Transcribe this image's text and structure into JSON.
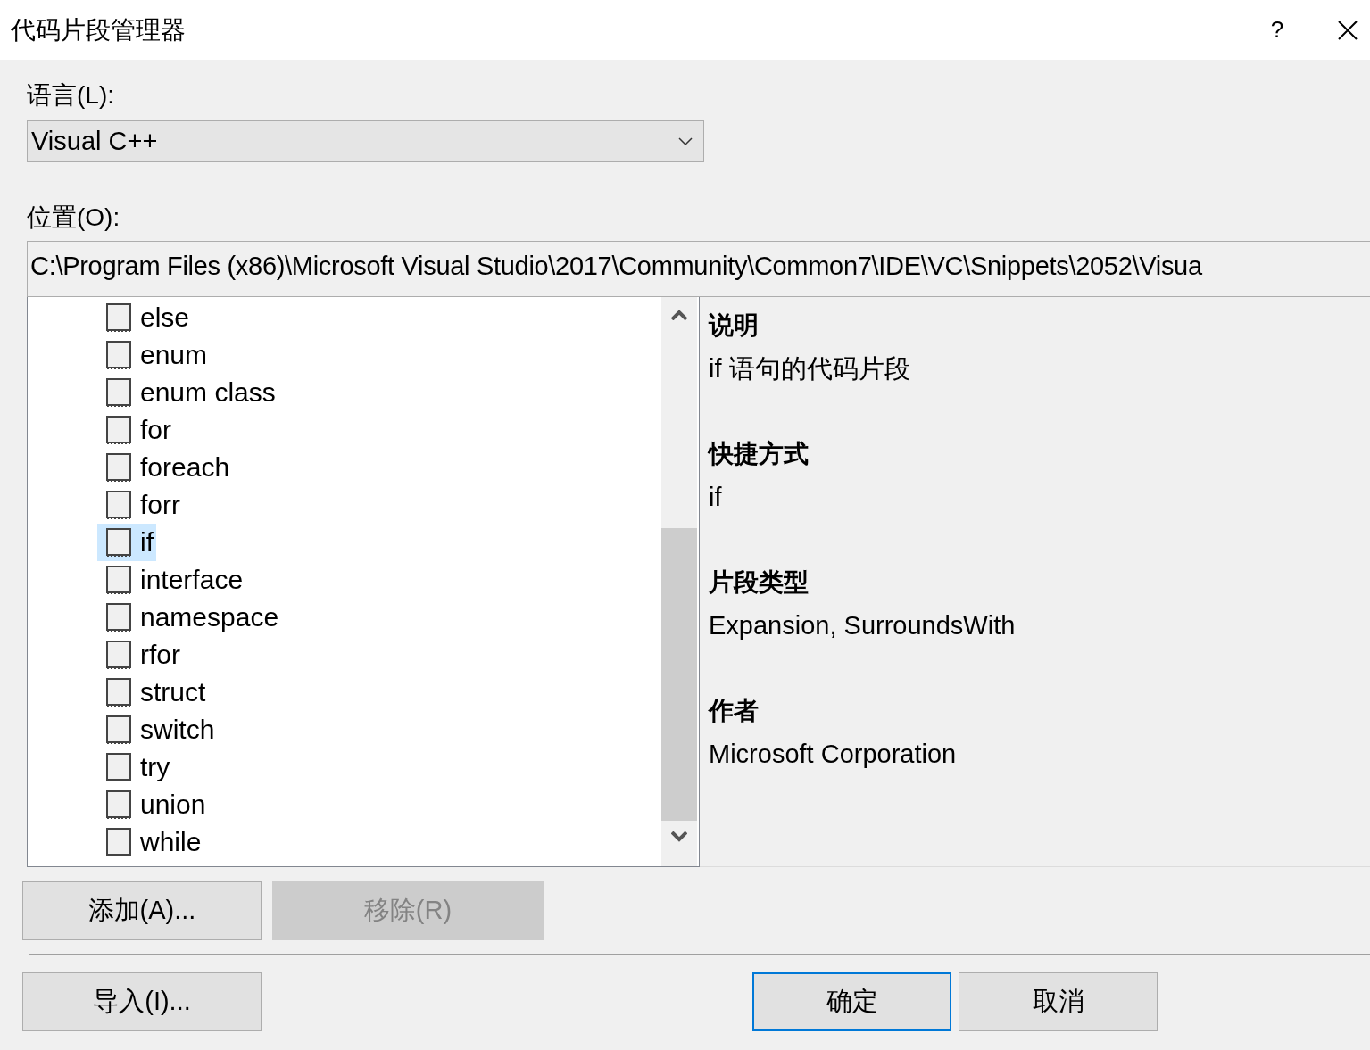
{
  "window": {
    "title": "代码片段管理器",
    "help": "?"
  },
  "language": {
    "label": "语言(L):",
    "value": "Visual C++"
  },
  "location": {
    "label": "位置(O):",
    "value": "C:\\Program Files (x86)\\Microsoft Visual Studio\\2017\\Community\\Common7\\IDE\\VC\\Snippets\\2052\\Visua"
  },
  "snippets": [
    {
      "label": "else",
      "selected": false
    },
    {
      "label": "enum",
      "selected": false
    },
    {
      "label": "enum class",
      "selected": false
    },
    {
      "label": "for",
      "selected": false
    },
    {
      "label": "foreach",
      "selected": false
    },
    {
      "label": "forr",
      "selected": false
    },
    {
      "label": "if",
      "selected": true
    },
    {
      "label": "interface",
      "selected": false
    },
    {
      "label": "namespace",
      "selected": false
    },
    {
      "label": "rfor",
      "selected": false
    },
    {
      "label": "struct",
      "selected": false
    },
    {
      "label": "switch",
      "selected": false
    },
    {
      "label": "try",
      "selected": false
    },
    {
      "label": "union",
      "selected": false
    },
    {
      "label": "while",
      "selected": false
    }
  ],
  "details": [
    {
      "heading": "说明",
      "value": "if 语句的代码片段"
    },
    {
      "heading": "快捷方式",
      "value": "if"
    },
    {
      "heading": "片段类型",
      "value": "Expansion, SurroundsWith"
    },
    {
      "heading": "作者",
      "value": "Microsoft Corporation"
    }
  ],
  "list_buttons": [
    {
      "label": "添加(A)...",
      "disabled": false
    },
    {
      "label": "移除(R)",
      "disabled": true
    }
  ],
  "footer_buttons": [
    {
      "label": "导入(I)...",
      "default": false
    },
    {
      "label": "确定",
      "default": true
    },
    {
      "label": "取消",
      "default": false
    }
  ]
}
